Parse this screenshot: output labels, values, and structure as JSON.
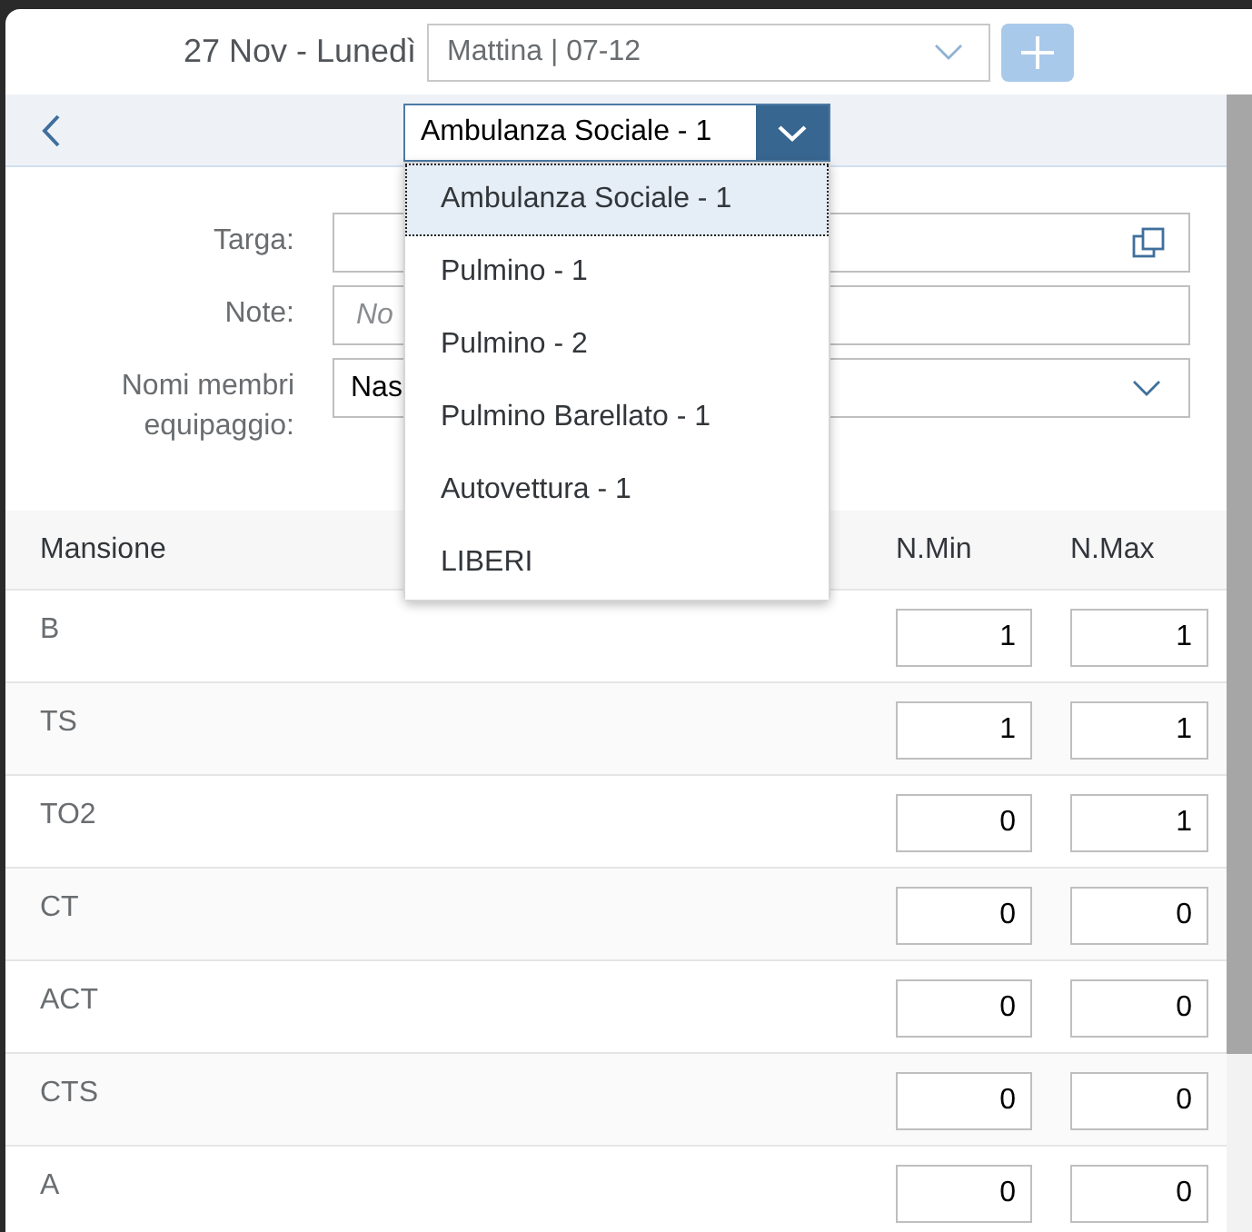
{
  "header": {
    "date": "27 Nov - Lunedì",
    "shift_select": {
      "value": "Mattina | 07-12"
    },
    "add_button": {
      "disabled": true
    }
  },
  "toolbar": {
    "vehicle_select": {
      "value": "Ambulanza Sociale - 1",
      "expanded": true,
      "options": [
        {
          "label": "Ambulanza Sociale - 1",
          "selected": true
        },
        {
          "label": "Pulmino - 1",
          "selected": false
        },
        {
          "label": "Pulmino - 2",
          "selected": false
        },
        {
          "label": "Pulmino Barellato - 1",
          "selected": false
        },
        {
          "label": "Autovettura - 1",
          "selected": false
        },
        {
          "label": "LIBERI",
          "selected": false
        }
      ]
    }
  },
  "form": {
    "fields": [
      {
        "label": "Targa:",
        "kind": "value_help"
      },
      {
        "label": "Note:",
        "kind": "text",
        "placeholder": "No"
      },
      {
        "label": "Nomi membri equipaggio:",
        "kind": "select",
        "value": "Nas"
      }
    ]
  },
  "table": {
    "columns": [
      "Mansione",
      "N.Min",
      "N.Max"
    ],
    "rows": [
      {
        "mansione": "B",
        "min": "1",
        "max": "1"
      },
      {
        "mansione": "TS",
        "min": "1",
        "max": "1"
      },
      {
        "mansione": "TO2",
        "min": "0",
        "max": "1"
      },
      {
        "mansione": "CT",
        "min": "0",
        "max": "0"
      },
      {
        "mansione": "ACT",
        "min": "0",
        "max": "0"
      },
      {
        "mansione": "CTS",
        "min": "0",
        "max": "0"
      },
      {
        "mansione": "A",
        "min": "0",
        "max": "0"
      }
    ]
  }
}
